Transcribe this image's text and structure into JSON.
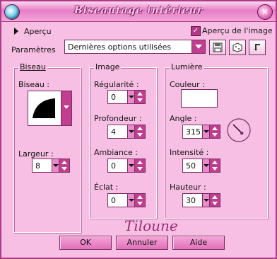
{
  "window": {
    "title": "Biseautage intérieur"
  },
  "top": {
    "preview_label": "Aperçu",
    "preview_image_label": "Aperçu de l'image",
    "preview_image_checked": true,
    "params_label": "Paramètres",
    "params_value": "Dernières options utilisées"
  },
  "groups": {
    "biseau": {
      "title": "Biseau",
      "biseau_label": "Biseau :",
      "largeur_label": "Largeur :",
      "largeur_value": "8"
    },
    "image": {
      "title": "Image",
      "regularite_label": "Régularité :",
      "regularite_value": "0",
      "profondeur_label": "Profondeur :",
      "profondeur_value": "4",
      "ambiance_label": "Ambiance :",
      "ambiance_value": "0",
      "eclat_label": "Éclat :",
      "eclat_value": "0"
    },
    "lumiere": {
      "title": "Lumière",
      "couleur_label": "Couleur :",
      "couleur_value": "#ffffff",
      "angle_label": "Angle :",
      "angle_value": "315",
      "intensite_label": "Intensité :",
      "intensite_value": "50",
      "hauteur_label": "Hauteur :",
      "hauteur_value": "30"
    }
  },
  "signature": "Tiloune",
  "buttons": {
    "ok": "OK",
    "cancel": "Annuler",
    "help": "Aide"
  },
  "colors": {
    "window_bg": "#f7bfe3",
    "accent": "#c03d8f",
    "border": "#7a2b62"
  },
  "icons": [
    "app-icon",
    "close-icon",
    "save-icon",
    "random-icon",
    "reset-icon"
  ]
}
